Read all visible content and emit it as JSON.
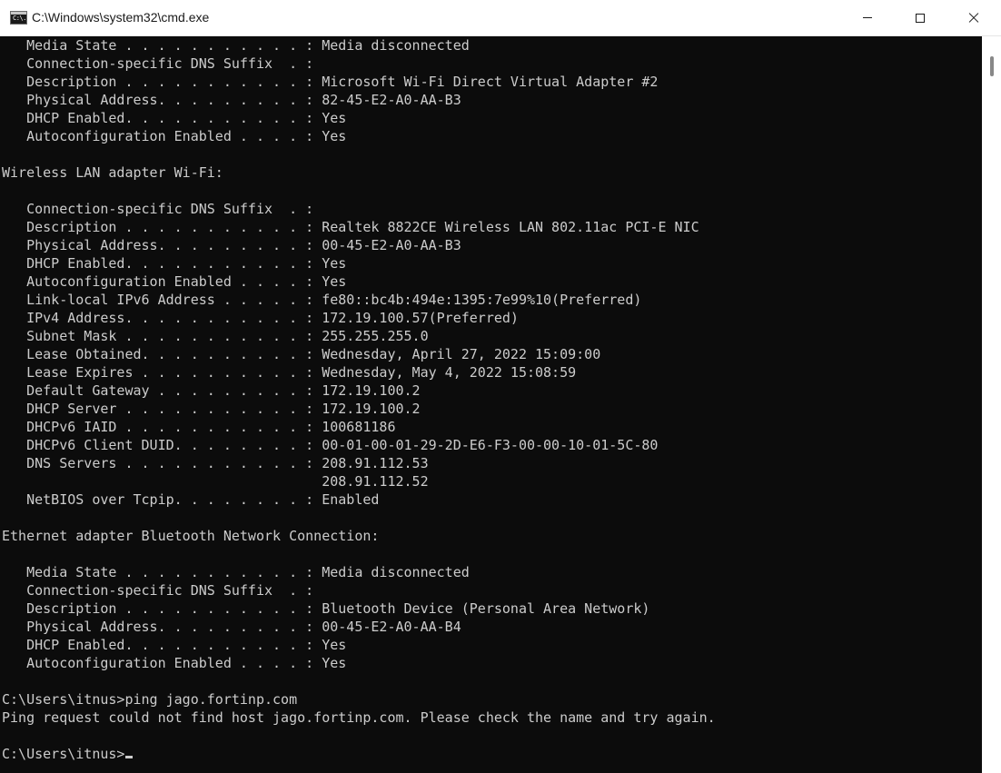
{
  "window": {
    "title": "C:\\Windows\\system32\\cmd.exe",
    "icon_name": "command-prompt-icon",
    "icon_glyph": "C:\\."
  },
  "console": {
    "lines": [
      "   Media State . . . . . . . . . . . : Media disconnected",
      "   Connection-specific DNS Suffix  . :",
      "   Description . . . . . . . . . . . : Microsoft Wi-Fi Direct Virtual Adapter #2",
      "   Physical Address. . . . . . . . . : 82-45-E2-A0-AA-B3",
      "   DHCP Enabled. . . . . . . . . . . : Yes",
      "   Autoconfiguration Enabled . . . . : Yes",
      "",
      "Wireless LAN adapter Wi-Fi:",
      "",
      "   Connection-specific DNS Suffix  . :",
      "   Description . . . . . . . . . . . : Realtek 8822CE Wireless LAN 802.11ac PCI-E NIC",
      "   Physical Address. . . . . . . . . : 00-45-E2-A0-AA-B3",
      "   DHCP Enabled. . . . . . . . . . . : Yes",
      "   Autoconfiguration Enabled . . . . : Yes",
      "   Link-local IPv6 Address . . . . . : fe80::bc4b:494e:1395:7e99%10(Preferred)",
      "   IPv4 Address. . . . . . . . . . . : 172.19.100.57(Preferred)",
      "   Subnet Mask . . . . . . . . . . . : 255.255.255.0",
      "   Lease Obtained. . . . . . . . . . : Wednesday, April 27, 2022 15:09:00",
      "   Lease Expires . . . . . . . . . . : Wednesday, May 4, 2022 15:08:59",
      "   Default Gateway . . . . . . . . . : 172.19.100.2",
      "   DHCP Server . . . . . . . . . . . : 172.19.100.2",
      "   DHCPv6 IAID . . . . . . . . . . . : 100681186",
      "   DHCPv6 Client DUID. . . . . . . . : 00-01-00-01-29-2D-E6-F3-00-00-10-01-5C-80",
      "   DNS Servers . . . . . . . . . . . : 208.91.112.53",
      "                                       208.91.112.52",
      "   NetBIOS over Tcpip. . . . . . . . : Enabled",
      "",
      "Ethernet adapter Bluetooth Network Connection:",
      "",
      "   Media State . . . . . . . . . . . : Media disconnected",
      "   Connection-specific DNS Suffix  . :",
      "   Description . . . . . . . . . . . : Bluetooth Device (Personal Area Network)",
      "   Physical Address. . . . . . . . . : 00-45-E2-A0-AA-B4",
      "   DHCP Enabled. . . . . . . . . . . : Yes",
      "   Autoconfiguration Enabled . . . . : Yes",
      "",
      "C:\\Users\\itnus>ping jago.fortinp.com",
      "Ping request could not find host jago.fortinp.com. Please check the name and try again.",
      ""
    ],
    "prompt": "C:\\Users\\itnus>"
  },
  "colors": {
    "background": "#0c0c0c",
    "foreground": "#cccccc",
    "titlebar": "#ffffff"
  }
}
